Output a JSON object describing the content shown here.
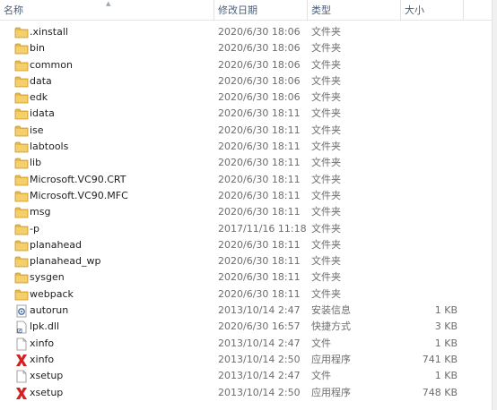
{
  "columns": {
    "name": "名称",
    "date": "修改日期",
    "type": "类型",
    "size": "大小"
  },
  "files": [
    {
      "name": ".xinstall",
      "date": "2020/6/30 18:06",
      "type": "文件夹",
      "size": "",
      "icon": "folder"
    },
    {
      "name": "bin",
      "date": "2020/6/30 18:06",
      "type": "文件夹",
      "size": "",
      "icon": "folder"
    },
    {
      "name": "common",
      "date": "2020/6/30 18:06",
      "type": "文件夹",
      "size": "",
      "icon": "folder"
    },
    {
      "name": "data",
      "date": "2020/6/30 18:06",
      "type": "文件夹",
      "size": "",
      "icon": "folder"
    },
    {
      "name": "edk",
      "date": "2020/6/30 18:06",
      "type": "文件夹",
      "size": "",
      "icon": "folder"
    },
    {
      "name": "idata",
      "date": "2020/6/30 18:11",
      "type": "文件夹",
      "size": "",
      "icon": "folder"
    },
    {
      "name": "ise",
      "date": "2020/6/30 18:11",
      "type": "文件夹",
      "size": "",
      "icon": "folder"
    },
    {
      "name": "labtools",
      "date": "2020/6/30 18:11",
      "type": "文件夹",
      "size": "",
      "icon": "folder"
    },
    {
      "name": "lib",
      "date": "2020/6/30 18:11",
      "type": "文件夹",
      "size": "",
      "icon": "folder"
    },
    {
      "name": "Microsoft.VC90.CRT",
      "date": "2020/6/30 18:11",
      "type": "文件夹",
      "size": "",
      "icon": "folder"
    },
    {
      "name": "Microsoft.VC90.MFC",
      "date": "2020/6/30 18:11",
      "type": "文件夹",
      "size": "",
      "icon": "folder"
    },
    {
      "name": "msg",
      "date": "2020/6/30 18:11",
      "type": "文件夹",
      "size": "",
      "icon": "folder"
    },
    {
      "name": "-p",
      "date": "2017/11/16 11:18",
      "type": "文件夹",
      "size": "",
      "icon": "folder"
    },
    {
      "name": "planahead",
      "date": "2020/6/30 18:11",
      "type": "文件夹",
      "size": "",
      "icon": "folder"
    },
    {
      "name": "planahead_wp",
      "date": "2020/6/30 18:11",
      "type": "文件夹",
      "size": "",
      "icon": "folder"
    },
    {
      "name": "sysgen",
      "date": "2020/6/30 18:11",
      "type": "文件夹",
      "size": "",
      "icon": "folder"
    },
    {
      "name": "webpack",
      "date": "2020/6/30 18:11",
      "type": "文件夹",
      "size": "",
      "icon": "folder"
    },
    {
      "name": "autorun",
      "date": "2013/10/14 2:47",
      "type": "安装信息",
      "size": "1 KB",
      "icon": "setup-info"
    },
    {
      "name": "lpk.dll",
      "date": "2020/6/30 16:57",
      "type": "快捷方式",
      "size": "3 KB",
      "icon": "shortcut"
    },
    {
      "name": "xinfo",
      "date": "2013/10/14 2:47",
      "type": "文件",
      "size": "1 KB",
      "icon": "file"
    },
    {
      "name": "xinfo",
      "date": "2013/10/14 2:50",
      "type": "应用程序",
      "size": "741 KB",
      "icon": "xilinx-app"
    },
    {
      "name": "xsetup",
      "date": "2013/10/14 2:47",
      "type": "文件",
      "size": "1 KB",
      "icon": "file"
    },
    {
      "name": "xsetup",
      "date": "2013/10/14 2:50",
      "type": "应用程序",
      "size": "748 KB",
      "icon": "xilinx-app"
    }
  ],
  "colors": {
    "folder": "#e8b84b",
    "folder_dark": "#c8962a",
    "xilinx_red": "#d42020",
    "header_text": "#4c607a"
  }
}
